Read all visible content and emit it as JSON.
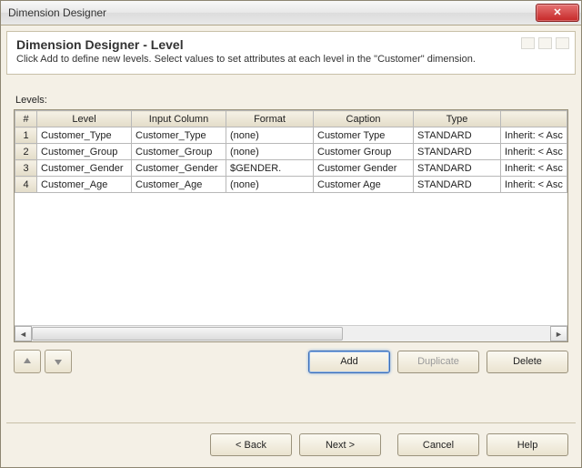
{
  "window": {
    "title": "Dimension Designer"
  },
  "header": {
    "title": "Dimension Designer - Level",
    "description": "Click Add to define new levels. Select values to set attributes at each level in the \"Customer\" dimension."
  },
  "levels_label": "Levels:",
  "table": {
    "columns": {
      "num": "#",
      "level": "Level",
      "input": "Input Column",
      "format": "Format",
      "caption": "Caption",
      "type": "Type",
      "sort": ""
    },
    "rows": [
      {
        "num": "1",
        "level": "Customer_Type",
        "input": "Customer_Type",
        "format": "(none)",
        "caption": "Customer Type",
        "type": "STANDARD",
        "sort": "Inherit: < Asc"
      },
      {
        "num": "2",
        "level": "Customer_Group",
        "input": "Customer_Group",
        "format": "(none)",
        "caption": "Customer Group",
        "type": "STANDARD",
        "sort": "Inherit: < Asc"
      },
      {
        "num": "3",
        "level": "Customer_Gender",
        "input": "Customer_Gender",
        "format": "$GENDER.",
        "caption": "Customer Gender",
        "type": "STANDARD",
        "sort": "Inherit: < Asc"
      },
      {
        "num": "4",
        "level": "Customer_Age",
        "input": "Customer_Age",
        "format": "(none)",
        "caption": "Customer Age",
        "type": "STANDARD",
        "sort": "Inherit: < Asc"
      }
    ]
  },
  "buttons": {
    "add": "Add",
    "duplicate": "Duplicate",
    "delete": "Delete",
    "back": "< Back",
    "next": "Next >",
    "cancel": "Cancel",
    "help": "Help"
  }
}
